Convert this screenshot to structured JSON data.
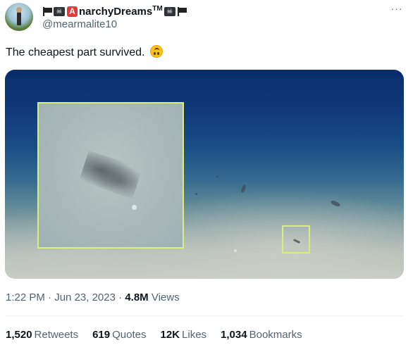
{
  "author": {
    "display_name_initial": "A",
    "display_name": "narchyDreams",
    "display_name_suffix": "TM",
    "handle": "@mearmalite10",
    "badge_icons": [
      "flag-icon",
      "pirate-flag-icon",
      "letter-a-icon",
      "pirate-flag-icon",
      "flag-icon"
    ]
  },
  "more_menu": {
    "label": "···"
  },
  "tweet": {
    "text": "The cheapest part survived.",
    "emoji": "upside-down-face-emoji"
  },
  "media": {
    "description_icon": "deep-sea-seafloor-photo",
    "highlight_color": "#d8ef7a"
  },
  "meta": {
    "time": "1:22 PM",
    "separator": "·",
    "date": "Jun 23, 2023",
    "views_count": "4.8M",
    "views_label": "Views"
  },
  "stats": [
    {
      "count": "1,520",
      "label": "Retweets"
    },
    {
      "count": "619",
      "label": "Quotes"
    },
    {
      "count": "12K",
      "label": "Likes"
    },
    {
      "count": "1,034",
      "label": "Bookmarks"
    }
  ]
}
